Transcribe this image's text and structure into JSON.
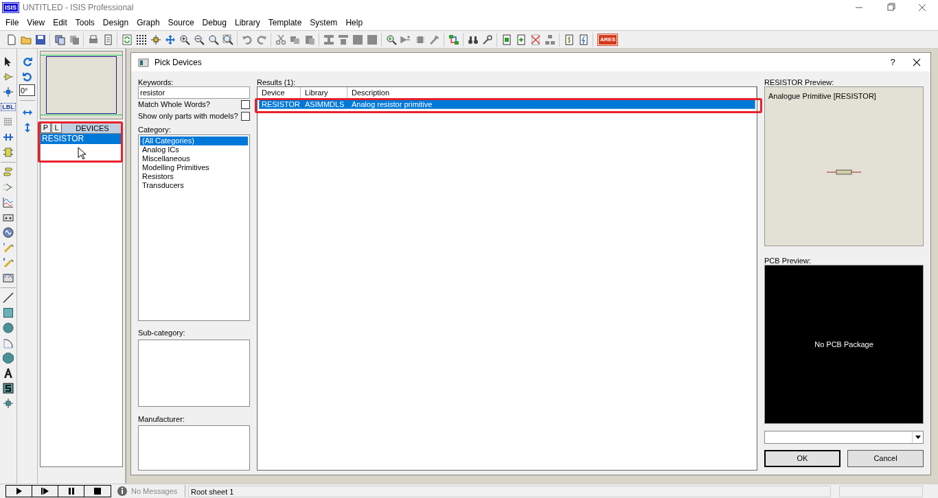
{
  "window": {
    "app_logo": "ISIS",
    "title": "UNTITLED - ISIS Professional"
  },
  "menu": [
    "File",
    "View",
    "Edit",
    "Tools",
    "Design",
    "Graph",
    "Source",
    "Debug",
    "Library",
    "Template",
    "System",
    "Help"
  ],
  "toolbar": {
    "ares_logo": "ARES"
  },
  "tool_palette": {
    "label_tool": "LBL"
  },
  "rotation_field": {
    "value": "0°"
  },
  "devices_panel": {
    "buttons": [
      "P",
      "L"
    ],
    "header": "DEVICES",
    "items": [
      {
        "label": "RESISTOR",
        "selected": true
      }
    ]
  },
  "dialog": {
    "title": "Pick Devices",
    "help": "?",
    "keywords": {
      "label": "Keywords:",
      "value": "resistor"
    },
    "options": [
      {
        "label": "Match Whole Words?",
        "checked": false
      },
      {
        "label": "Show only parts with models?",
        "checked": false
      }
    ],
    "category": {
      "label": "Category:",
      "items": [
        {
          "label": "(All Categories)",
          "selected": true
        },
        {
          "label": "Analog ICs",
          "selected": false
        },
        {
          "label": "Miscellaneous",
          "selected": false
        },
        {
          "label": "Modelling Primitives",
          "selected": false
        },
        {
          "label": "Resistors",
          "selected": false
        },
        {
          "label": "Transducers",
          "selected": false
        }
      ]
    },
    "subcategory": {
      "label": "Sub-category:"
    },
    "manufacturer": {
      "label": "Manufacturer:"
    },
    "results": {
      "label": "Results (1):",
      "columns": [
        "Device",
        "Library",
        "Description"
      ],
      "rows": [
        {
          "cells": [
            "RESISTOR",
            "ASIMMDLS",
            "Analog resistor primitive"
          ],
          "selected": true
        }
      ]
    },
    "preview": {
      "label": "RESISTOR Preview:",
      "caption": "Analogue Primitive [RESISTOR]"
    },
    "pcb_preview": {
      "label": "PCB Preview:",
      "message": "No PCB Package"
    },
    "buttons": [
      "OK",
      "Cancel"
    ]
  },
  "status_bar": {
    "messages": "No Messages",
    "sheet": "Root sheet 1"
  }
}
